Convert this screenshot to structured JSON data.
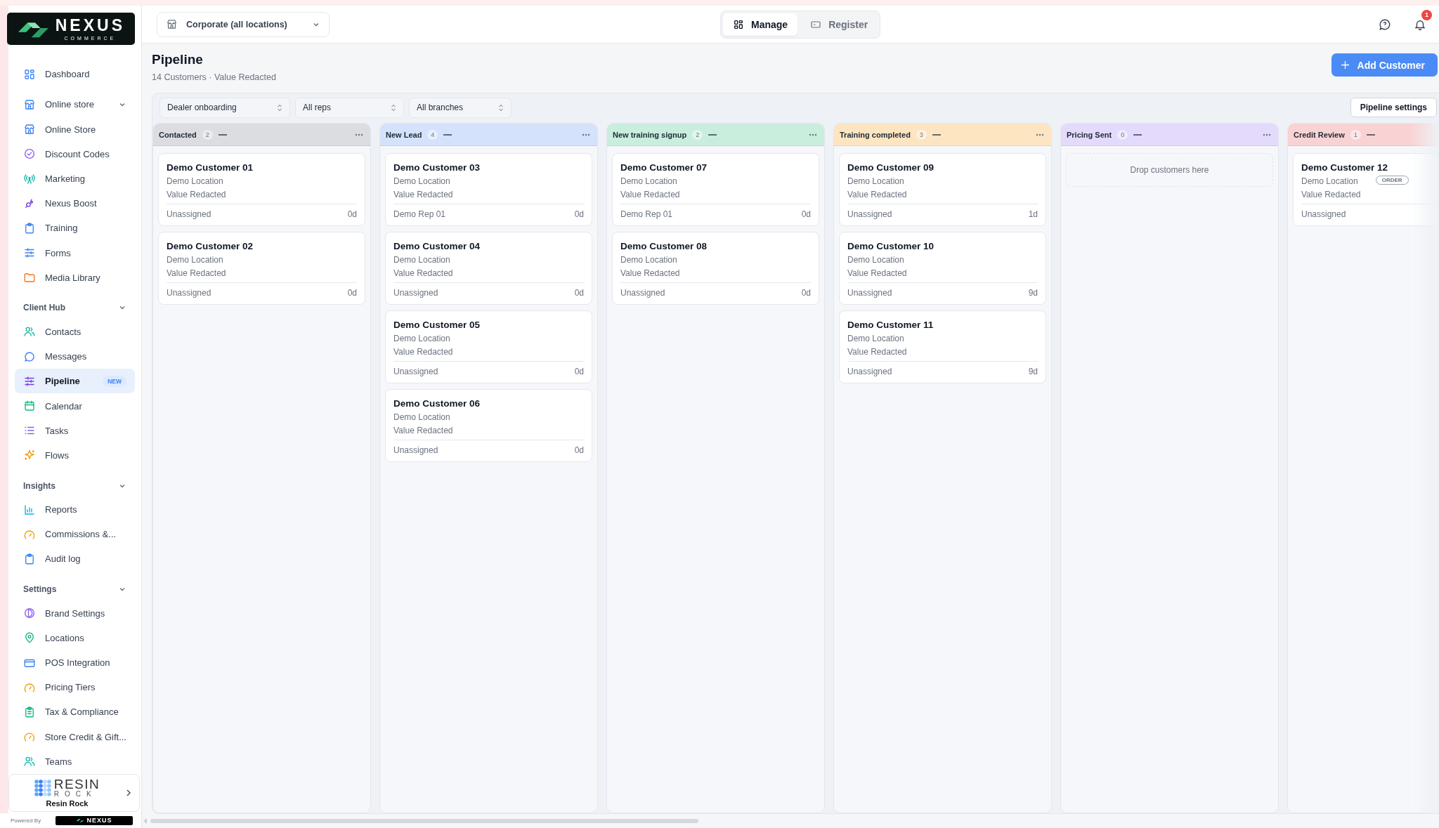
{
  "brand": {
    "name": "NEXUS",
    "tagline": "COMMERCE"
  },
  "sidebar": {
    "groups": [
      {
        "kind": "plain",
        "items": [
          {
            "label": "Dashboard",
            "selected": false
          }
        ]
      },
      {
        "kind": "nav",
        "label": "Online store",
        "expanded": true,
        "items": [
          {
            "label": "Online Store",
            "selected": false
          },
          {
            "label": "Discount Codes",
            "selected": false
          },
          {
            "label": "Marketing",
            "selected": false
          },
          {
            "label": "Nexus Boost",
            "selected": false
          },
          {
            "label": "Training",
            "selected": false
          },
          {
            "label": "Forms",
            "selected": false
          },
          {
            "label": "Media Library",
            "selected": false
          }
        ]
      },
      {
        "kind": "section",
        "label": "Client Hub",
        "expanded": true,
        "items": [
          {
            "label": "Contacts",
            "selected": false
          },
          {
            "label": "Messages",
            "selected": false
          },
          {
            "label": "Pipeline",
            "selected": true,
            "badge": "NEW"
          },
          {
            "label": "Calendar",
            "selected": false
          },
          {
            "label": "Tasks",
            "selected": false
          },
          {
            "label": "Flows",
            "selected": false
          }
        ]
      },
      {
        "kind": "section",
        "label": "Insights",
        "expanded": true,
        "items": [
          {
            "label": "Reports",
            "selected": false
          },
          {
            "label": "Commissions &...",
            "selected": false
          },
          {
            "label": "Audit log",
            "selected": false
          }
        ]
      },
      {
        "kind": "section",
        "label": "Settings",
        "expanded": true,
        "items": [
          {
            "label": "Brand Settings",
            "selected": false
          },
          {
            "label": "Locations",
            "selected": false
          },
          {
            "label": "POS Integration",
            "selected": false
          },
          {
            "label": "Pricing Tiers",
            "selected": false
          },
          {
            "label": "Tax & Compliance",
            "selected": false
          },
          {
            "label": "Store Credit & Gift...",
            "selected": false
          },
          {
            "label": "Teams",
            "selected": false
          }
        ]
      }
    ],
    "account": {
      "logo_top": "RESIN",
      "logo_bottom": "ROCK",
      "name": "Resin Rock"
    },
    "footer": {
      "label": "Powered By",
      "logo": "NEXUS"
    }
  },
  "header": {
    "location": "Corporate (all locations)",
    "modes": [
      {
        "label": "Manage",
        "selected": true
      },
      {
        "label": "Register",
        "selected": false
      }
    ],
    "notifications": "1"
  },
  "page": {
    "title": "Pipeline",
    "subtitle": "14 Customers · Value Redacted",
    "add_button": "Add Customer"
  },
  "filters": [
    "Dealer onboarding",
    "All reps",
    "All branches"
  ],
  "settings_button": "Pipeline settings",
  "columns": [
    {
      "name": "Contacted",
      "count": "2",
      "color": "#dcdde1",
      "cards": [
        {
          "name": "Demo Customer 01",
          "location": "Demo Location",
          "value": "Value Redacted",
          "assignee": "Unassigned",
          "age": "0d"
        },
        {
          "name": "Demo Customer 02",
          "location": "Demo Location",
          "value": "Value Redacted",
          "assignee": "Unassigned",
          "age": "0d"
        }
      ]
    },
    {
      "name": "New Lead",
      "count": "4",
      "color": "#d4e2fb",
      "cards": [
        {
          "name": "Demo Customer 03",
          "location": "Demo Location",
          "value": "Value Redacted",
          "assignee": "Demo Rep 01",
          "age": "0d"
        },
        {
          "name": "Demo Customer 04",
          "location": "Demo Location",
          "value": "Value Redacted",
          "assignee": "Unassigned",
          "age": "0d"
        },
        {
          "name": "Demo Customer 05",
          "location": "Demo Location",
          "value": "Value Redacted",
          "assignee": "Unassigned",
          "age": "0d"
        },
        {
          "name": "Demo Customer 06",
          "location": "Demo Location",
          "value": "Value Redacted",
          "assignee": "Unassigned",
          "age": "0d"
        }
      ]
    },
    {
      "name": "New training signup",
      "count": "2",
      "color": "#c9eedd",
      "cards": [
        {
          "name": "Demo Customer 07",
          "location": "Demo Location",
          "value": "Value Redacted",
          "assignee": "Demo Rep 01",
          "age": "0d"
        },
        {
          "name": "Demo Customer 08",
          "location": "Demo Location",
          "value": "Value Redacted",
          "assignee": "Unassigned",
          "age": "0d"
        }
      ]
    },
    {
      "name": "Training completed",
      "count": "3",
      "color": "#fde5c2",
      "cards": [
        {
          "name": "Demo Customer 09",
          "location": "Demo Location",
          "value": "Value Redacted",
          "assignee": "Unassigned",
          "age": "1d"
        },
        {
          "name": "Demo Customer 10",
          "location": "Demo Location",
          "value": "Value Redacted",
          "assignee": "Unassigned",
          "age": "9d"
        },
        {
          "name": "Demo Customer 11",
          "location": "Demo Location",
          "value": "Value Redacted",
          "assignee": "Unassigned",
          "age": "9d"
        }
      ]
    },
    {
      "name": "Pricing Sent",
      "count": "0",
      "color": "#e3dafc",
      "empty_text": "Drop customers here"
    },
    {
      "name": "Credit Review",
      "count": "1",
      "color": "#f9d3d3",
      "cards": [
        {
          "name": "Demo Customer 12",
          "location": "Demo Location",
          "tag": "ORDER",
          "value": "Value Redacted",
          "assignee": "Unassigned"
        }
      ]
    }
  ]
}
